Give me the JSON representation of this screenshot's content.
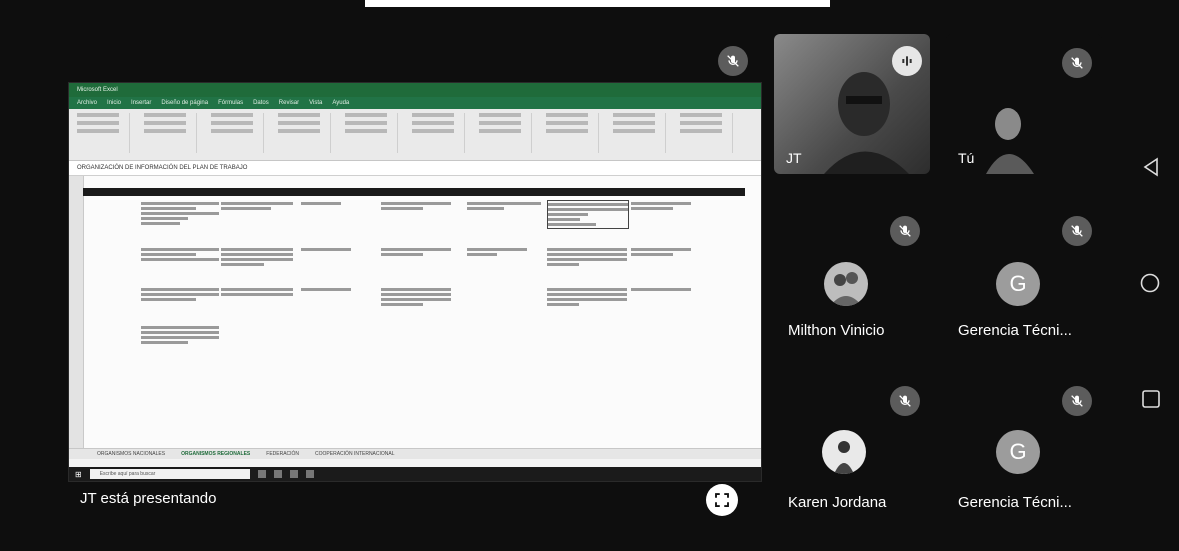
{
  "presentation": {
    "presenter_label": "JT está presentando",
    "excel": {
      "title_text": "Microsoft Excel",
      "tabs": [
        "Archivo",
        "Inicio",
        "Insertar",
        "Diseño de página",
        "Fórmulas",
        "Datos",
        "Revisar",
        "Vista",
        "Ayuda"
      ],
      "formula_text": "ORGANIZACIÓN DE INFORMACIÓN DEL PLAN DE TRABAJO",
      "sheet_tabs": [
        "ORGANISMOS NACIONALES",
        "ORGANISMOS REGIONALES",
        "FEDERACIÓN",
        "COOPERACIÓN INTERNACIONAL"
      ],
      "search_placeholder": "Escribe aquí para buscar"
    }
  },
  "participants": [
    {
      "name": "JT",
      "type": "video",
      "muted": false,
      "speaking": true
    },
    {
      "name": "Tú",
      "type": "video",
      "muted": true
    },
    {
      "name": "Milthon Vinicio",
      "type": "photo",
      "muted": true
    },
    {
      "name": "Gerencia Técni...",
      "type": "letter",
      "letter": "G",
      "muted": true
    },
    {
      "name": "Karen Jordana",
      "type": "photo",
      "muted": true
    },
    {
      "name": "Gerencia Técni...",
      "type": "letter",
      "letter": "G",
      "muted": true
    }
  ],
  "icons": {
    "mic_off": "mic-off-icon",
    "speaking": "audio-wave-icon",
    "fullscreen": "fullscreen-icon",
    "nav_back": "back-triangle-icon",
    "nav_home": "home-circle-icon",
    "nav_recents": "recents-square-icon"
  },
  "colors": {
    "background": "#0e0e0e",
    "tile": "#3a3a3a",
    "mute_badge": "#5c5c5c",
    "avatar_letter_bg": "#9c9c9c",
    "excel_green": "#217346"
  }
}
